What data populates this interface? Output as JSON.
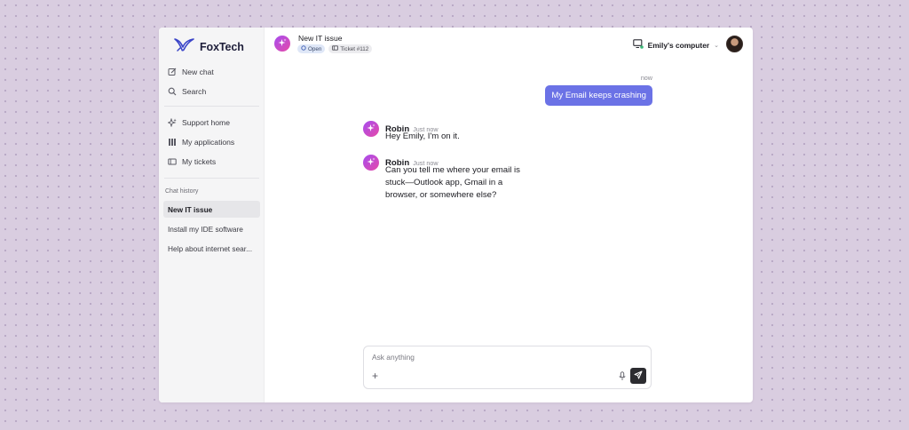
{
  "brand": {
    "name": "FoxTech",
    "logo_icon": "bird-logo-icon",
    "accent": "#3a44c8"
  },
  "sidebar": {
    "nav": [
      {
        "label": "New chat",
        "icon": "edit-icon"
      },
      {
        "label": "Search",
        "icon": "search-icon"
      }
    ],
    "nav2": [
      {
        "label": "Support home",
        "icon": "sparkle-icon"
      },
      {
        "label": "My applications",
        "icon": "grid-icon"
      },
      {
        "label": "My tickets",
        "icon": "ticket-icon"
      }
    ],
    "history_label": "Chat history",
    "history": [
      {
        "label": "New IT issue",
        "active": true
      },
      {
        "label": "Install my IDE software",
        "active": false
      },
      {
        "label": "Help about internet sear...",
        "active": false
      }
    ]
  },
  "header": {
    "title": "New IT issue",
    "status_badge": "Open",
    "ticket_badge": "Ticket #112",
    "computer_label": "Emily's computer",
    "computer_status_color": "#3cb878"
  },
  "chat": {
    "user_message": {
      "time": "now",
      "text": "My Email keeps crashing",
      "color": "#6b72e6"
    },
    "bot_messages": [
      {
        "name": "Robin",
        "time": "Just now",
        "text": "Hey Emily, I'm on it."
      },
      {
        "name": "Robin",
        "time": "Just now",
        "text": "Can you tell me where your email is stuck—Outlook app, Gmail in a browser, or somewhere else?"
      }
    ]
  },
  "composer": {
    "placeholder": "Ask anything",
    "value": ""
  }
}
